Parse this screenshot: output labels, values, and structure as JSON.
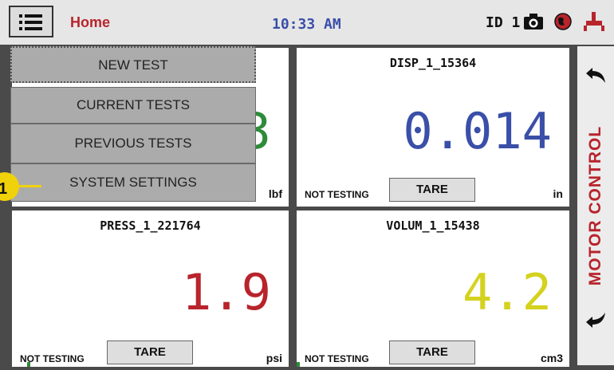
{
  "header": {
    "menu_icon": "hamburger-menu-icon",
    "title": "Home",
    "time": "10:33 AM",
    "id_label": "ID 1",
    "icons": [
      "camera-icon",
      "globe-icon",
      "plug-icon"
    ]
  },
  "menu": {
    "items": [
      {
        "label": "NEW TEST"
      },
      {
        "label": "CURRENT TESTS"
      },
      {
        "label": "PREVIOUS TESTS"
      },
      {
        "label": "SYSTEM SETTINGS"
      }
    ]
  },
  "callout": {
    "number": "1",
    "color": "#f0d20a"
  },
  "panels": [
    {
      "title": "",
      "value": "3",
      "status": "",
      "tare_label": "",
      "unit": "lbf",
      "value_color": "#2e8b3a"
    },
    {
      "title": "DISP_1_15364",
      "value": "0.014",
      "status": "NOT TESTING",
      "tare_label": "TARE",
      "unit": "in",
      "value_color": "#3a4fa8"
    },
    {
      "title": "PRESS_1_221764",
      "value": "1.9",
      "status": "NOT TESTING",
      "tare_label": "TARE",
      "unit": "psi",
      "value_color": "#b8242c"
    },
    {
      "title": "VOLUM_1_15438",
      "value": "4.2",
      "status": "NOT TESTING",
      "tare_label": "TARE",
      "unit": "cm3",
      "value_color": "#d4d21e"
    }
  ],
  "motor_control": {
    "label": "MOTOR CONTROL",
    "up_icon": "arrow-up-left-icon",
    "down_icon": "arrow-down-left-icon"
  },
  "colors": {
    "accent_red": "#b8242c",
    "time_blue": "#3a4fa8"
  }
}
